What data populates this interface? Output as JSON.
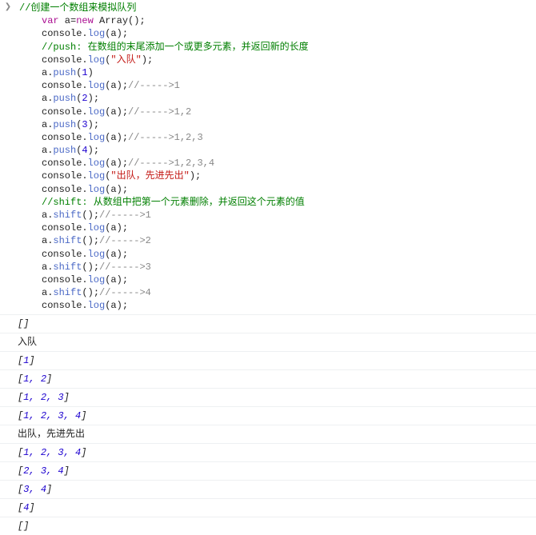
{
  "code": {
    "l01": "//创建一个数组来模拟队列",
    "l02_var": "var",
    "l02_a": " a=",
    "l02_new": "new",
    "l02_arr": " Array();",
    "l03a": "console.",
    "l03b": "log",
    "l03c": "(a);",
    "l04a": "//push:",
    "l04b": " 在数组的末尾添加一个或更多元素，并返回新的长度",
    "l05a": "console.",
    "l05b": "log",
    "l05c": "(",
    "l05d": "\"入队\"",
    "l05e": ");",
    "l06a": "a.",
    "l06b": "push",
    "l06c": "(",
    "l06n": "1",
    "l06d": ")",
    "l07a": "console.",
    "l07b": "log",
    "l07c": "(a);",
    "l07cm": "//----->1",
    "l08a": "a.",
    "l08b": "push",
    "l08c": "(",
    "l08n": "2",
    "l08d": ");",
    "l09a": "console.",
    "l09b": "log",
    "l09c": "(a);",
    "l09cm": "//----->1,2",
    "l10a": "a.",
    "l10b": "push",
    "l10c": "(",
    "l10n": "3",
    "l10d": ");",
    "l11a": "console.",
    "l11b": "log",
    "l11c": "(a);",
    "l11cm": "//----->1,2,3",
    "l12a": "a.",
    "l12b": "push",
    "l12c": "(",
    "l12n": "4",
    "l12d": ");",
    "l13a": "console.",
    "l13b": "log",
    "l13c": "(a);",
    "l13cm": "//----->1,2,3,4",
    "l14a": "console.",
    "l14b": "log",
    "l14c": "(",
    "l14d": "\"出队，先进先出\"",
    "l14e": ");",
    "l15a": "console.",
    "l15b": "log",
    "l15c": "(a);",
    "l16a": "//shift:",
    "l16b": " 从数组中把第一个元素删除，并返回这个元素的值",
    "l17a": "a.",
    "l17b": "shift",
    "l17c": "();",
    "l17cm": "//----->1",
    "l18a": "console.",
    "l18b": "log",
    "l18c": "(a);",
    "l19a": "a.",
    "l19b": "shift",
    "l19c": "();",
    "l19cm": "//----->2",
    "l20a": "console.",
    "l20b": "log",
    "l20c": "(a);",
    "l21a": "a.",
    "l21b": "shift",
    "l21c": "();",
    "l21cm": "//----->3",
    "l22a": "console.",
    "l22b": "log",
    "l22c": "(a);",
    "l23a": "a.",
    "l23b": "shift",
    "l23c": "();",
    "l23cm": "//----->4",
    "l24a": "console.",
    "l24b": "log",
    "l24c": "(a);"
  },
  "out": {
    "lb": "[",
    "rb": "]",
    "c": ",",
    "sp": " ",
    "n1": "1",
    "n2": "2",
    "n3": "3",
    "n4": "4",
    "r2": "入队",
    "r8": "出队，先进先出"
  }
}
